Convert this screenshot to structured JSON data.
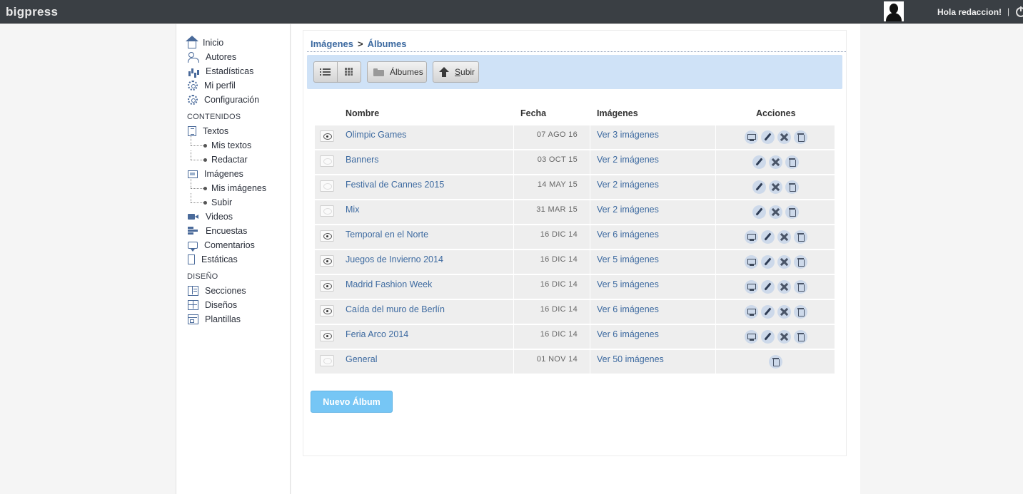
{
  "app": {
    "brand": "bigpress",
    "greeting": "Hola redaccion!",
    "separator": "|"
  },
  "sidebar": {
    "main": [
      {
        "label": "Inicio",
        "icon": "home-icon"
      },
      {
        "label": "Autores",
        "icon": "users-icon"
      },
      {
        "label": "Estadísticas",
        "icon": "stats-icon"
      },
      {
        "label": "Mi perfil",
        "icon": "profile-gear-icon"
      },
      {
        "label": "Configuración",
        "icon": "settings-gear-icon"
      }
    ],
    "contents_title": "CONTENIDOS",
    "contents": {
      "textos": "Textos",
      "mis_textos": "Mis textos",
      "redactar": "Redactar",
      "imagenes": "Imágenes",
      "mis_imagenes": "Mis imágenes",
      "subir": "Subir",
      "videos": "Videos",
      "encuestas": "Encuestas",
      "comentarios": "Comentarios",
      "estaticas": "Estáticas"
    },
    "design_title": "DISEÑO",
    "design": {
      "secciones": "Secciones",
      "disenos": "Diseños",
      "plantillas": "Plantillas"
    }
  },
  "breadcrumb": {
    "parent": "Imágenes",
    "arrow": ">",
    "current": "Álbumes"
  },
  "toolbar": {
    "albums_label": "Álbumes",
    "upload_label": "Subir"
  },
  "table": {
    "headers": {
      "name": "Nombre",
      "date": "Fecha",
      "images": "Imágenes",
      "actions": "Acciones"
    },
    "rows": [
      {
        "name": "Olimpic Games",
        "date": "07 AGO 16",
        "images": "Ver 3 imágenes",
        "visible": true,
        "actions": [
          "monitor",
          "edit",
          "close",
          "trash"
        ]
      },
      {
        "name": "Banners",
        "date": "03 OCT 15",
        "images": "Ver 2 imágenes",
        "visible": false,
        "actions": [
          "edit",
          "close",
          "trash"
        ]
      },
      {
        "name": "Festival de Cannes 2015",
        "date": "14 MAY 15",
        "images": "Ver 2 imágenes",
        "visible": false,
        "actions": [
          "edit",
          "close",
          "trash"
        ]
      },
      {
        "name": "Mix",
        "date": "31 MAR 15",
        "images": "Ver 2 imágenes",
        "visible": false,
        "actions": [
          "edit",
          "close",
          "trash"
        ]
      },
      {
        "name": "Temporal en el Norte",
        "date": "16 DIC 14",
        "images": "Ver 6 imágenes",
        "visible": true,
        "actions": [
          "monitor",
          "edit",
          "close",
          "trash"
        ]
      },
      {
        "name": "Juegos de Invierno 2014",
        "date": "16 DIC 14",
        "images": "Ver 5 imágenes",
        "visible": true,
        "actions": [
          "monitor",
          "edit",
          "close",
          "trash"
        ]
      },
      {
        "name": "Madrid Fashion Week",
        "date": "16 DIC 14",
        "images": "Ver 5 imágenes",
        "visible": true,
        "actions": [
          "monitor",
          "edit",
          "close",
          "trash"
        ]
      },
      {
        "name": "Caída del muro de Berlín",
        "date": "16 DIC 14",
        "images": "Ver 6 imágenes",
        "visible": true,
        "actions": [
          "monitor",
          "edit",
          "close",
          "trash"
        ]
      },
      {
        "name": "Feria Arco 2014",
        "date": "16 DIC 14",
        "images": "Ver 6 imágenes",
        "visible": true,
        "actions": [
          "monitor",
          "edit",
          "close",
          "trash"
        ]
      },
      {
        "name": "General",
        "date": "01 NOV 14",
        "images": "Ver 50 imágenes",
        "visible": false,
        "actions": [
          "trash"
        ]
      }
    ]
  },
  "new_album_label": "Nuevo Álbum"
}
